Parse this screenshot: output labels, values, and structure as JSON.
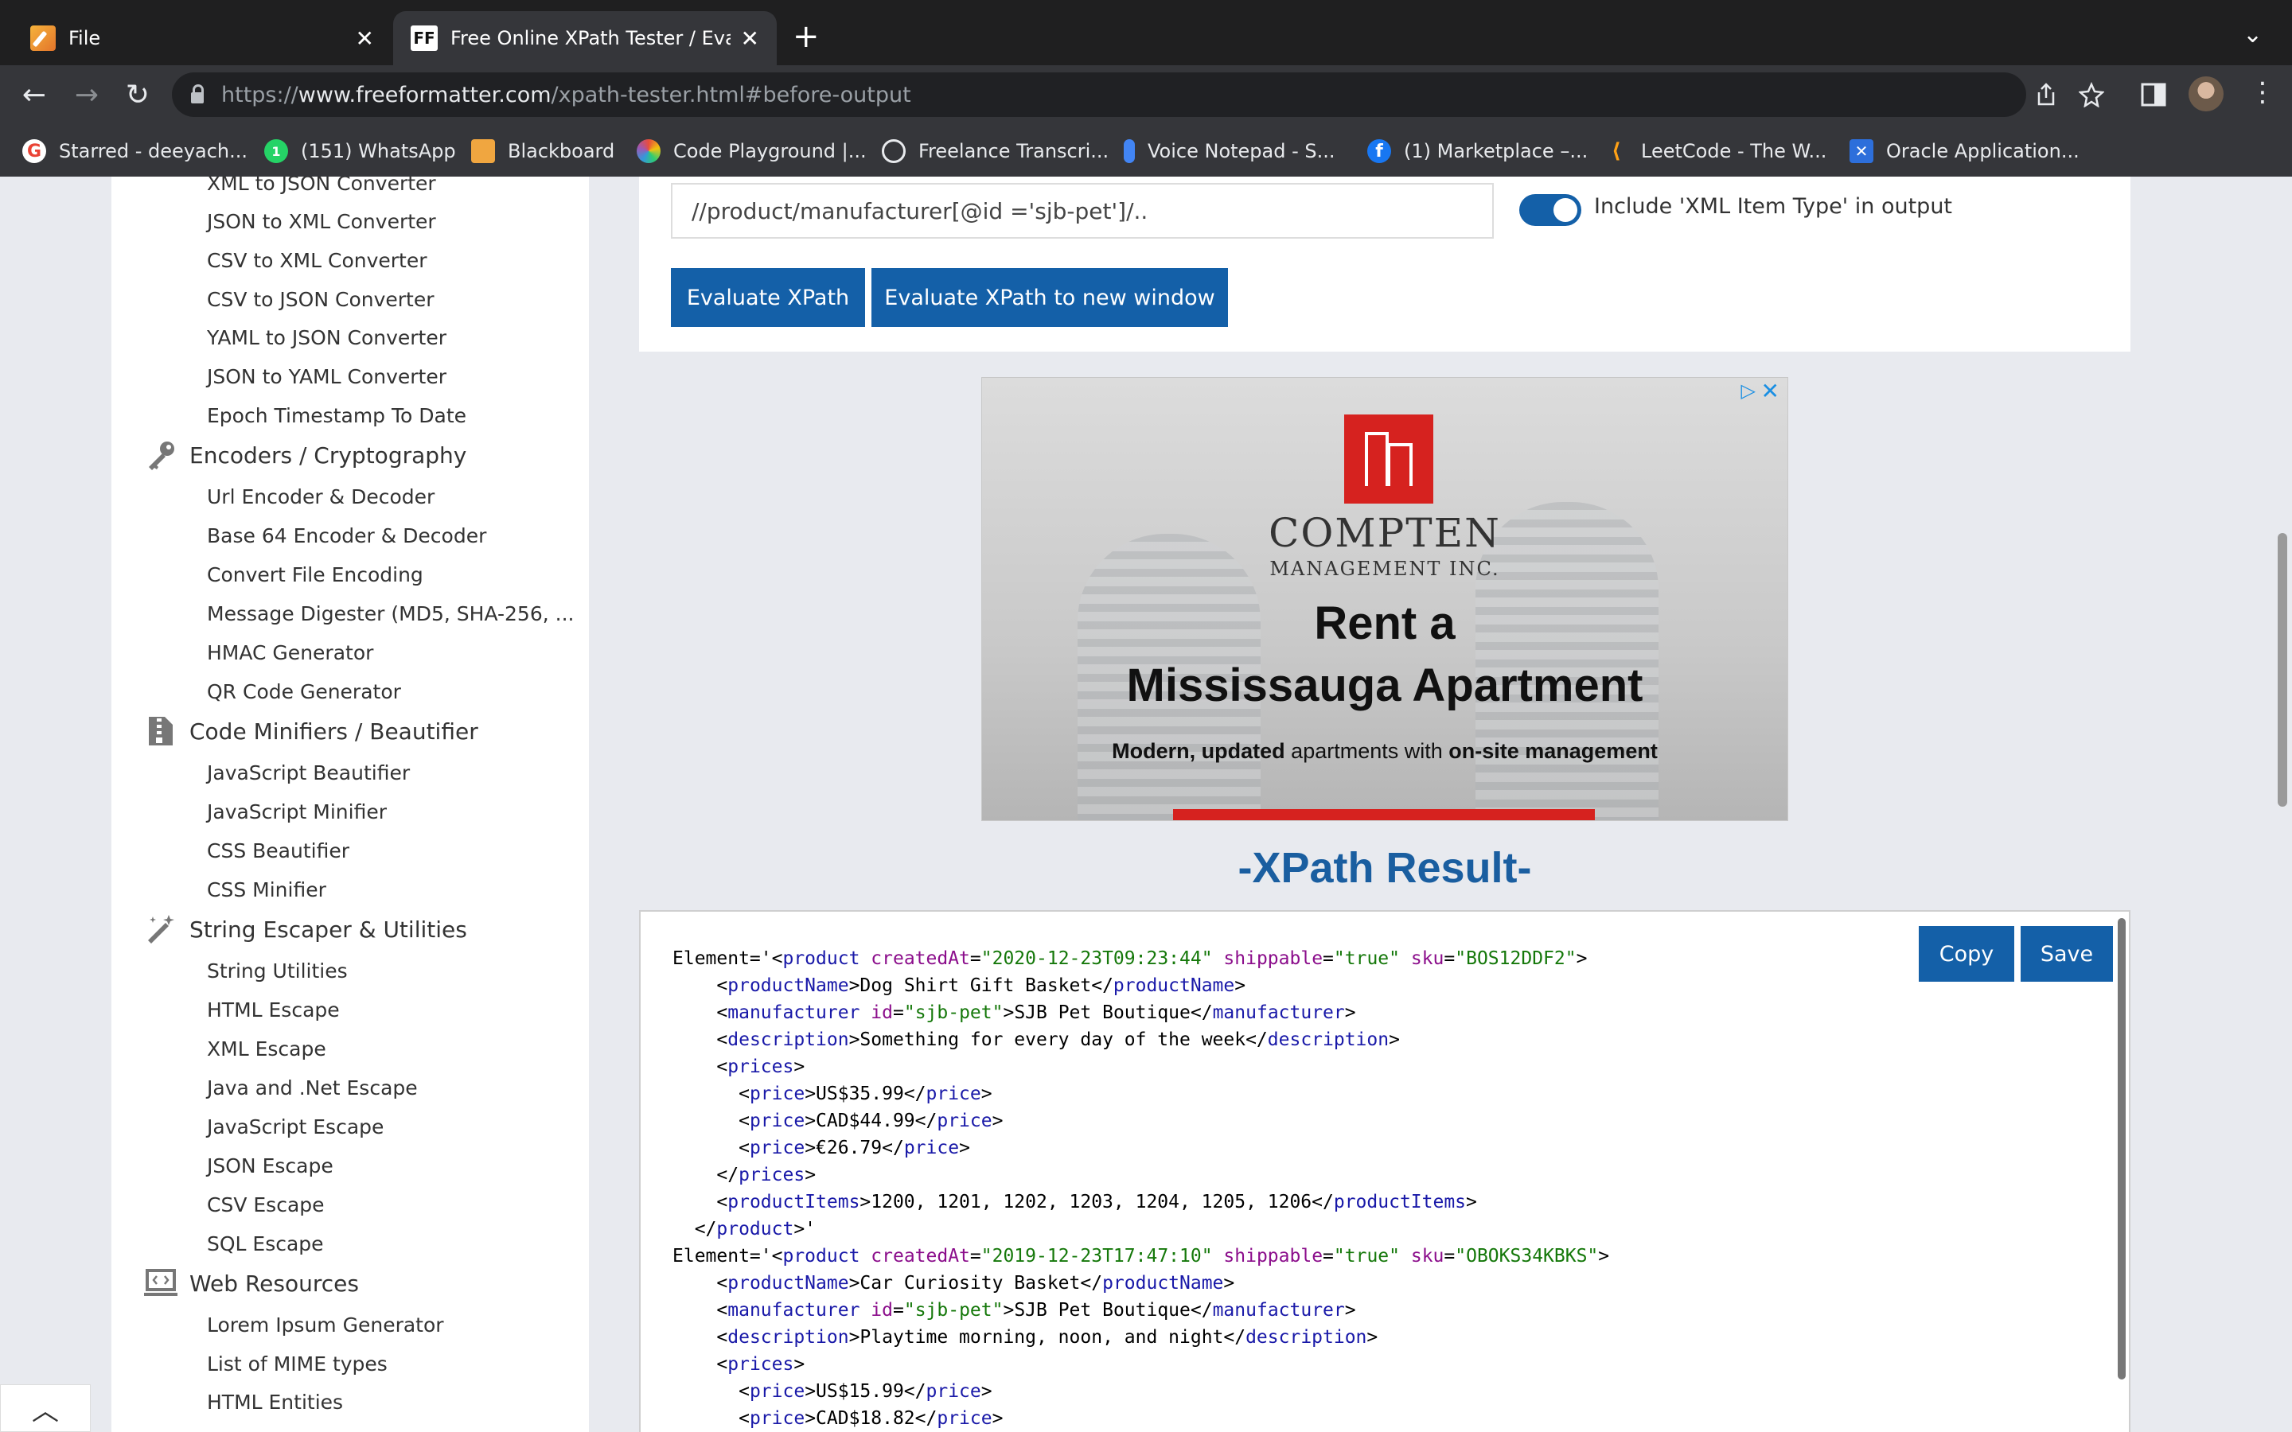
{
  "tabs": [
    {
      "title": "File",
      "close": "✕"
    },
    {
      "favicon": "FF",
      "title": "Free Online XPath Tester / Evaluator",
      "close": "✕"
    }
  ],
  "new_tab": "+",
  "tab_menu": "⌄",
  "nav": {
    "back": "←",
    "forward": "→",
    "reload": "↻"
  },
  "address": {
    "scheme": "https://",
    "host": "www.freeformatter.com",
    "path": "/xpath-tester.html#before-output"
  },
  "toolbar_icons": {
    "share": "share-icon",
    "bookmark": "star-icon",
    "sidebar": "side-panel-icon",
    "menu": "⋮"
  },
  "bookmarks": [
    {
      "label": "Starred - deeyach...",
      "icon": "google-icon",
      "color": "#ea4335"
    },
    {
      "label": "(151) WhatsApp",
      "icon": "whatsapp-icon",
      "color": "#25d366"
    },
    {
      "label": "Blackboard",
      "icon": "blackboard-icon",
      "color": "#f0a640"
    },
    {
      "label": "Code Playground |...",
      "icon": "code-playground-icon",
      "color": "#7b3fe4"
    },
    {
      "label": "Freelance Transcri...",
      "icon": "transcription-icon",
      "color": "#ffffff"
    },
    {
      "label": "Voice Notepad - S...",
      "icon": "microphone-icon",
      "color": "#4285f4"
    },
    {
      "label": "(1) Marketplace –...",
      "icon": "facebook-icon",
      "color": "#1877f2"
    },
    {
      "label": "LeetCode - The W...",
      "icon": "leetcode-icon",
      "color": "#ffa116"
    },
    {
      "label": "Oracle Application...",
      "icon": "oracle-icon",
      "color": "#2d6fdb"
    }
  ],
  "sidebar": {
    "converters": [
      "XML to JSON Converter",
      "JSON to XML Converter",
      "CSV to XML Converter",
      "CSV to JSON Converter",
      "YAML to JSON Converter",
      "JSON to YAML Converter",
      "Epoch Timestamp To Date"
    ],
    "cat_encoders": "Encoders / Cryptography",
    "encoders": [
      "Url Encoder & Decoder",
      "Base 64 Encoder & Decoder",
      "Convert File Encoding",
      "Message Digester (MD5, SHA-256, ...",
      "HMAC Generator",
      "QR Code Generator"
    ],
    "cat_minifiers": "Code Minifiers / Beautifier",
    "minifiers": [
      "JavaScript Beautifier",
      "JavaScript Minifier",
      "CSS Beautifier",
      "CSS Minifier"
    ],
    "cat_escaper": "String Escaper & Utilities",
    "escaper": [
      "String Utilities",
      "HTML Escape",
      "XML Escape",
      "Java and .Net Escape",
      "JavaScript Escape",
      "JSON Escape",
      "CSV Escape",
      "SQL Escape"
    ],
    "cat_web": "Web Resources",
    "web": [
      "Lorem Ipsum Generator",
      "List of MIME types",
      "HTML Entities"
    ]
  },
  "xpath": {
    "expression": "//product/manufacturer[@id ='sjb-pet']/..",
    "include_type_label": "Include 'XML Item Type' in output",
    "include_type_on": true,
    "evaluate_label": "Evaluate XPath",
    "evaluate_new_label": "Evaluate XPath to new window"
  },
  "ad": {
    "brand": "COMPTEN",
    "brand_sub": "MANAGEMENT INC.",
    "headline_1": "Rent a",
    "headline_2": "Mississauga Apartment",
    "body_1": "Modern, updated",
    "body_2": " apartments with ",
    "body_3": "on-site management",
    "adchoices": "▷",
    "close": "✕"
  },
  "result": {
    "title": "-XPath Result-",
    "copy_label": "Copy",
    "save_label": "Save"
  },
  "back_to_top": "︿"
}
